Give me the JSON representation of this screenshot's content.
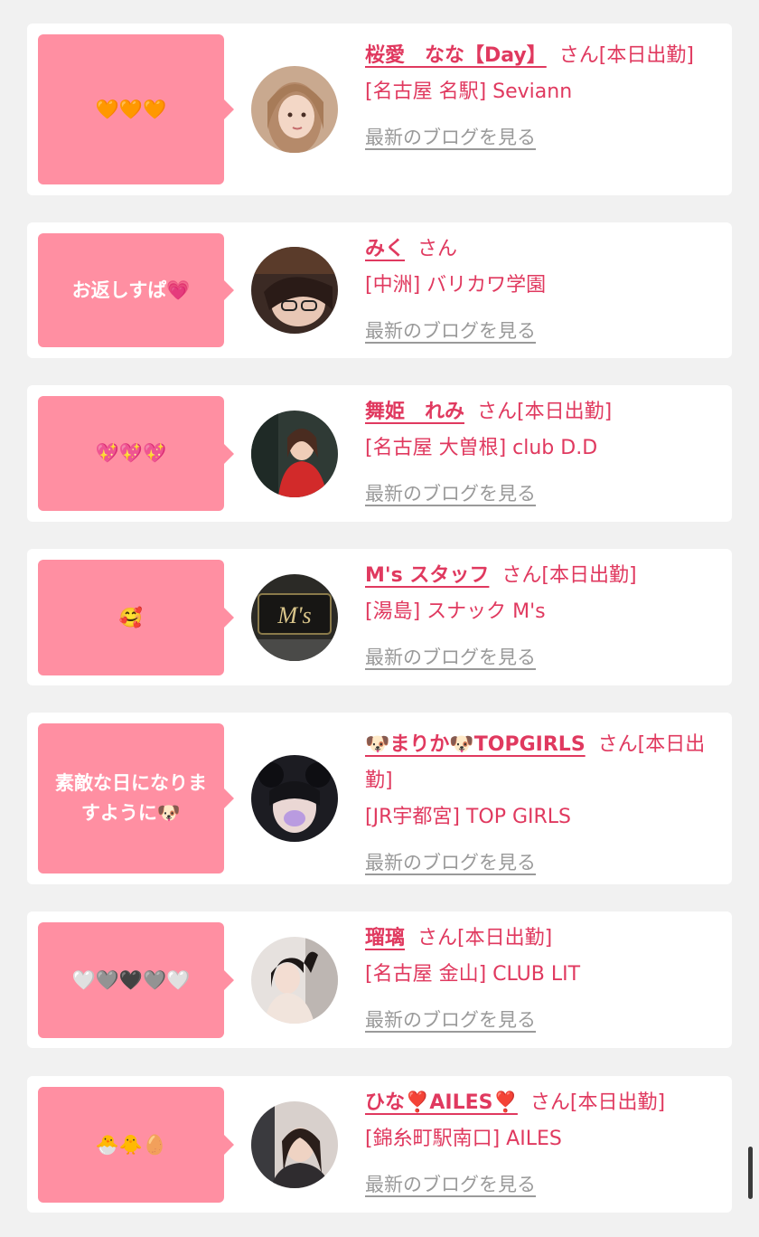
{
  "entries": [
    {
      "message": "🧡🧡🧡",
      "name": "桜愛　なな【Day】",
      "suffix": "さん[本日出勤]",
      "shop": "[名古屋 名駅] Seviann",
      "blog_link": "最新のブログを見る"
    },
    {
      "message": "お返しすぱ💗",
      "name": "みく",
      "suffix": "さん",
      "shop": "[中洲] バリカワ学園",
      "blog_link": "最新のブログを見る"
    },
    {
      "message": "💖💖💖",
      "name": "舞姫　れみ",
      "suffix": "さん[本日出勤]",
      "shop": "[名古屋 大曽根] club D.D",
      "blog_link": "最新のブログを見る"
    },
    {
      "message": "🥰",
      "name": "M's スタッフ",
      "suffix": "さん[本日出勤]",
      "shop": "[湯島] スナック M's",
      "blog_link": "最新のブログを見る",
      "avatar_text": "M's"
    },
    {
      "message": "素敵な日になりますように🐶",
      "name": "🐶まりか🐶TOPGIRLS",
      "suffix": "さん[本日出勤]",
      "shop": "[JR宇都宮] TOP GIRLS",
      "blog_link": "最新のブログを見る"
    },
    {
      "message": "🤍🩶🖤🩶🤍",
      "name": "瑠璃",
      "suffix": "さん[本日出勤]",
      "shop": "[名古屋 金山] CLUB LIT",
      "blog_link": "最新のブログを見る"
    },
    {
      "message": "🐣🐥🥚",
      "name": "ひな❣️AILES❣️",
      "suffix": "さん[本日出勤]",
      "shop": "[錦糸町駅南口] AILES",
      "blog_link": "最新のブログを見る"
    }
  ],
  "colors": {
    "page_bg": "#f1f1f1",
    "card_bg": "#ffffff",
    "bubble_bg": "#ff8fa2",
    "accent": "#e0395f",
    "link_gray": "#9a9a9a"
  }
}
